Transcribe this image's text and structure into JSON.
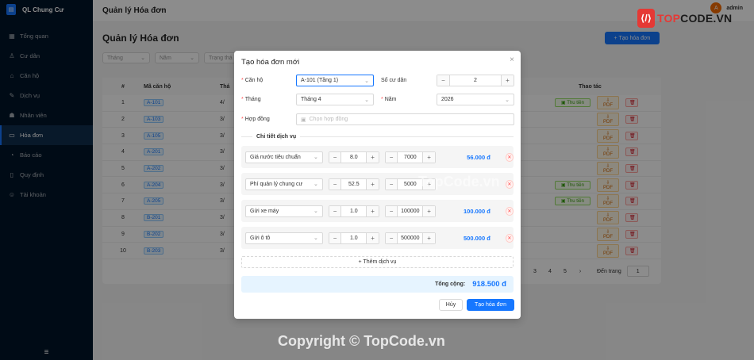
{
  "app": {
    "name": "QL Chung Cư",
    "logo": "building-icon"
  },
  "sidebar": {
    "items": [
      {
        "label": "Tổng quan",
        "icon": "grid-icon"
      },
      {
        "label": "Cư dân",
        "icon": "user-icon"
      },
      {
        "label": "Căn hộ",
        "icon": "home-icon"
      },
      {
        "label": "Dịch vụ",
        "icon": "tool-icon"
      },
      {
        "label": "Nhân viên",
        "icon": "team-icon"
      },
      {
        "label": "Hóa đơn",
        "icon": "file-icon",
        "active": true
      },
      {
        "label": "Báo cáo",
        "icon": "chart-icon"
      },
      {
        "label": "Quy định",
        "icon": "book-icon"
      },
      {
        "label": "Tài khoản",
        "icon": "account-icon"
      }
    ]
  },
  "header": {
    "title": "Quản lý Hóa đơn",
    "user": "admin",
    "avatar": "A"
  },
  "page": {
    "title": "Quản lý Hóa đơn",
    "create_label": "+ Tạo hóa đơn",
    "filters": [
      "Tháng",
      "Năm",
      "Trạng thá"
    ],
    "columns": {
      "idx": "#",
      "apt": "Mã căn hộ",
      "month": "Thá",
      "actions": "Thao tác"
    },
    "pay_label": "Thu tiền",
    "pdf_label": "PDF",
    "rows": [
      {
        "idx": "1",
        "apt": "A-101",
        "month": "4/",
        "pay": true
      },
      {
        "idx": "2",
        "apt": "A-103",
        "month": "3/",
        "pay": false
      },
      {
        "idx": "3",
        "apt": "A-105",
        "month": "3/",
        "pay": false
      },
      {
        "idx": "4",
        "apt": "A-201",
        "month": "3/",
        "pay": false
      },
      {
        "idx": "5",
        "apt": "A-202",
        "month": "3/",
        "pay": false
      },
      {
        "idx": "6",
        "apt": "A-204",
        "month": "3/",
        "pay": true
      },
      {
        "idx": "7",
        "apt": "A-205",
        "month": "3/",
        "pay": true
      },
      {
        "idx": "8",
        "apt": "B-201",
        "month": "3/",
        "pay": false
      },
      {
        "idx": "9",
        "apt": "B-202",
        "month": "3/",
        "pay": false
      },
      {
        "idx": "10",
        "apt": "B-203",
        "month": "3/",
        "pay": false
      }
    ],
    "pagination": {
      "pages": [
        "3",
        "4",
        "5"
      ],
      "next": "›",
      "jump_label": "Đến trang",
      "jump_value": "1"
    }
  },
  "modal": {
    "title": "Tạo hóa đơn mới",
    "close": "×",
    "fields": {
      "apartment": {
        "label": "Căn hộ",
        "value": "A-101 (Tầng 1)"
      },
      "residents": {
        "label": "Số cư dân",
        "value": "2"
      },
      "month": {
        "label": "Tháng",
        "value": "Tháng 4"
      },
      "year": {
        "label": "Năm",
        "value": "2026"
      },
      "contract": {
        "label": "Hợp đồng",
        "placeholder": "Chọn hợp đồng"
      }
    },
    "section_title": "Chi tiết dịch vụ",
    "services": [
      {
        "name": "Giá nước tiêu chuẩn",
        "qty": "8.0",
        "price": "7000",
        "amount": "56.000 đ"
      },
      {
        "name": "Phí quản lý chung cư",
        "qty": "52.5",
        "price": "5000",
        "amount": ""
      },
      {
        "name": "Gửi xe máy",
        "qty": "1.0",
        "price": "100000",
        "amount": "100.000 đ"
      },
      {
        "name": "Gửi ô tô",
        "qty": "1.0",
        "price": "500000",
        "amount": "500.000 đ"
      }
    ],
    "add_service_label": "+ Thêm dịch vụ",
    "total_label": "Tổng cộng:",
    "total_value": "918.500 đ",
    "cancel_label": "Hủy",
    "submit_label": "Tạo hóa đơn"
  },
  "watermarks": {
    "logo_prefix": "TOP",
    "logo_rest": "CODE.VN",
    "center": "TopCode.vn",
    "bottom": "Copyright © TopCode.vn"
  },
  "colors": {
    "primary": "#1677ff",
    "sidebar": "#001529",
    "danger": "#ff4d4f"
  }
}
